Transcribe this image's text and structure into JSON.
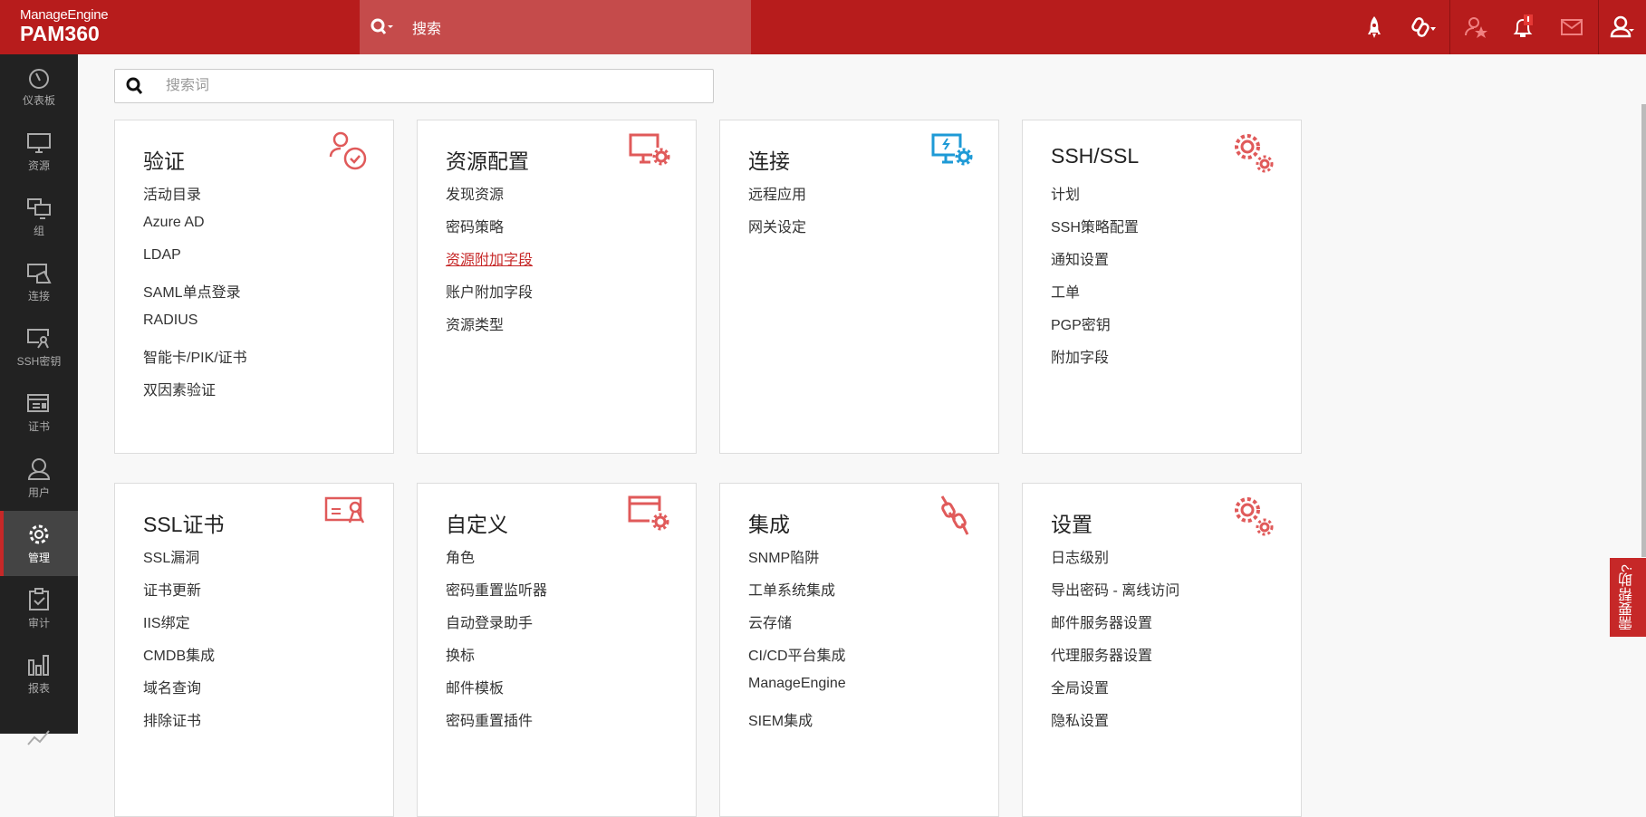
{
  "header": {
    "brand_top": "ManageEngine",
    "brand": "PAM360",
    "search_label": "搜索"
  },
  "search": {
    "placeholder": "搜索词"
  },
  "sidebar": {
    "items": [
      {
        "label": "仪表板"
      },
      {
        "label": "资源"
      },
      {
        "label": "组"
      },
      {
        "label": "连接"
      },
      {
        "label": "SSH密钥"
      },
      {
        "label": "证书"
      },
      {
        "label": "用户"
      },
      {
        "label": "管理",
        "active": true
      },
      {
        "label": "审计"
      },
      {
        "label": "报表"
      }
    ]
  },
  "cards": [
    {
      "title": "验证",
      "items": [
        "活动目录",
        "Azure AD",
        "LDAP",
        "SAML单点登录",
        "RADIUS",
        "智能卡/PIK/证书",
        "双因素验证"
      ]
    },
    {
      "title": "资源配置",
      "items": [
        "发现资源",
        "密码策略",
        "资源附加字段",
        "账户附加字段",
        "资源类型"
      ],
      "selected": "资源附加字段"
    },
    {
      "title": "连接",
      "items": [
        "远程应用",
        "网关设定"
      ]
    },
    {
      "title": "SSH/SSL",
      "items": [
        "计划",
        "SSH策略配置",
        "通知设置",
        "工单",
        "PGP密钥",
        "附加字段"
      ]
    },
    {
      "title": "SSL证书",
      "items": [
        "SSL漏洞",
        "证书更新",
        "IIS绑定",
        "CMDB集成",
        "域名查询",
        "排除证书"
      ]
    },
    {
      "title": "自定义",
      "items": [
        "角色",
        "密码重置监听器",
        "自动登录助手",
        "换标",
        "邮件模板",
        "密码重置插件"
      ]
    },
    {
      "title": "集成",
      "items": [
        "SNMP陷阱",
        "工单系统集成",
        "云存储",
        "CI/CD平台集成",
        "ManageEngine",
        "SIEM集成"
      ]
    },
    {
      "title": "设置",
      "items": [
        "日志级别",
        "导出密码 - 离线访问",
        "邮件服务器设置",
        "代理服务器设置",
        "全局设置",
        "隐私设置"
      ]
    }
  ],
  "help": {
    "label": "需要帮助?"
  },
  "colors": {
    "brand": "#b71c1c",
    "accent": "#e05a5a",
    "blue": "#1e9ad6"
  }
}
